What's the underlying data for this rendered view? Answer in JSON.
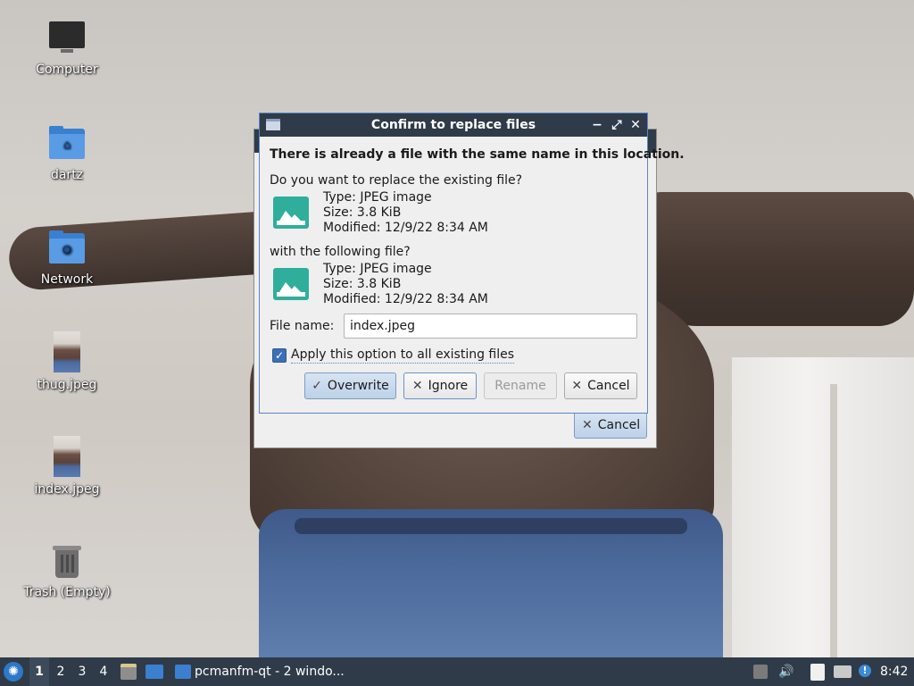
{
  "desktop": {
    "icons": [
      {
        "label": "Computer",
        "icon": "monitor-icon"
      },
      {
        "label": "dartz",
        "icon": "home-folder-icon"
      },
      {
        "label": "Network",
        "icon": "network-folder-icon"
      },
      {
        "label": "thug.jpeg",
        "icon": "image-thumbnail-icon"
      },
      {
        "label": "index.jpeg",
        "icon": "image-thumbnail-icon"
      },
      {
        "label": "Trash (Empty)",
        "icon": "trash-icon"
      }
    ]
  },
  "background_dialog": {
    "cancel_label": "Cancel"
  },
  "dialog": {
    "title": "Confirm to replace files",
    "controls": {
      "minimize": "−",
      "maximize": "⤢",
      "close": "✕"
    },
    "headline": "There is already a file with the same name in this location.",
    "question": "Do you want to replace the existing file?",
    "existing_file": {
      "type": "Type: JPEG image",
      "size": "Size: 3.8 KiB",
      "modified": "Modified: 12/9/22 8:34 AM"
    },
    "with_text": "with the following file?",
    "new_file": {
      "type": "Type: JPEG image",
      "size": "Size: 3.8 KiB",
      "modified": "Modified: 12/9/22 8:34 AM"
    },
    "filename_label": "File name:",
    "filename_value": "index.jpeg",
    "apply_all_label": "Apply this option to all existing files",
    "apply_all_checked": true,
    "buttons": {
      "overwrite": "Overwrite",
      "ignore": "Ignore",
      "rename": "Rename",
      "cancel": "Cancel"
    }
  },
  "taskbar": {
    "workspaces": [
      "1",
      "2",
      "3",
      "4"
    ],
    "active_workspace": "1",
    "task_label": "pcmanfm-qt - 2 windo...",
    "clock": "8:42"
  },
  "colors": {
    "titlebar": "#2f3b48",
    "accent": "#3b6fb6",
    "image_icon": "#2fae9b"
  }
}
